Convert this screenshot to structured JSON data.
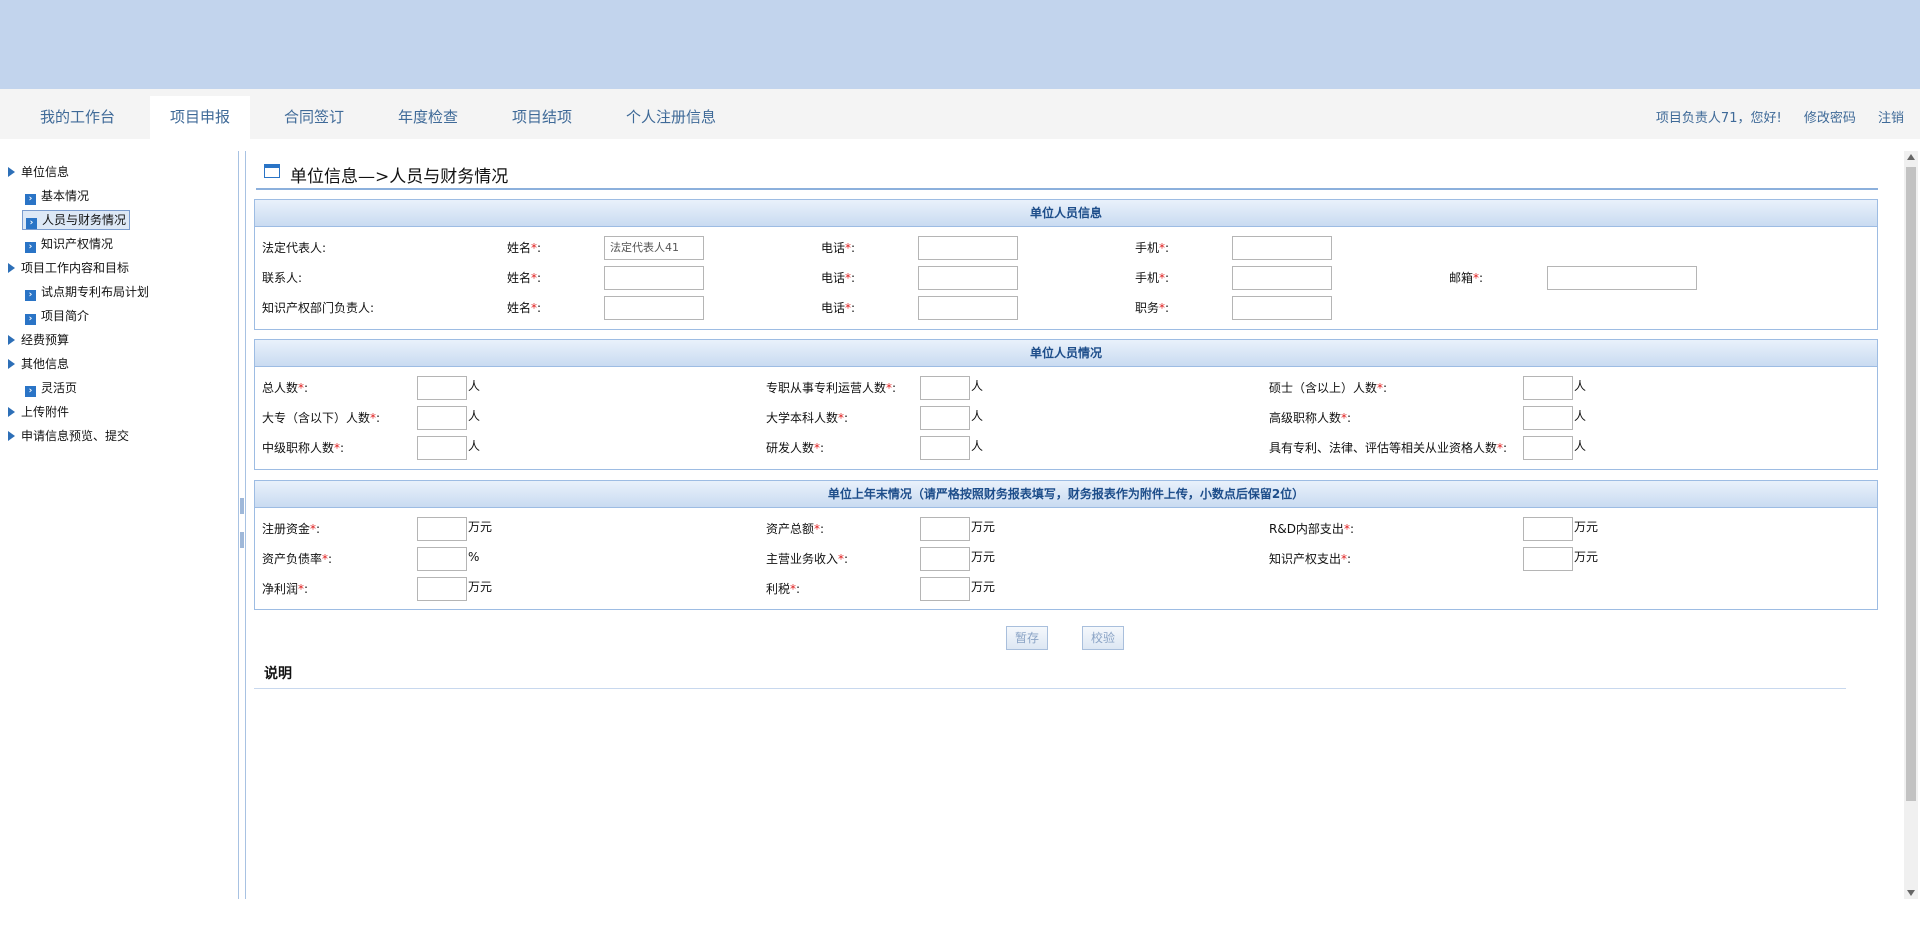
{
  "nav": {
    "tabs": [
      "我的工作台",
      "项目申报",
      "合同签订",
      "年度检查",
      "项目结项",
      "个人注册信息"
    ],
    "active_tab": "项目申报",
    "greeting": "项目负责人71，您好!",
    "change_password": "修改密码",
    "logout": "注销"
  },
  "sidebar": {
    "unit_info": "单位信息",
    "basic": "基本情况",
    "staff_finance": "人员与财务情况",
    "ip": "知识产权情况",
    "project_goals": "项目工作内容和目标",
    "pilot_plan": "试点期专利布局计划",
    "project_intro": "项目简介",
    "budget": "经费预算",
    "other": "其他信息",
    "flexible_page": "灵活页",
    "upload": "上传附件",
    "preview_submit": "申请信息预览、提交"
  },
  "page": {
    "title": "单位信息—>人员与财务情况"
  },
  "personnel_info": {
    "header": "单位人员信息",
    "legal_rep": "法定代表人:",
    "contact": "联系人:",
    "ip_head": "知识产权部门负责人:",
    "name": "姓名",
    "phone": "电话",
    "mobile": "手机",
    "email": "邮箱",
    "position": "职务",
    "req_mark": "*",
    "colon": ":",
    "legal_rep_name_value": "法定代表人41"
  },
  "personnel_stats": {
    "header": "单位人员情况",
    "total": "总人数",
    "patent_ops": "专职从事专利运营人数",
    "masters": "硕士（含以上）人数",
    "college": "大专（含以下）人数",
    "bachelor": "大学本科人数",
    "senior_title": "高级职称人数",
    "mid_title": "中级职称人数",
    "rnd": "研发人数",
    "qualified": "具有专利、法律、评估等相关从业资格人数",
    "unit": "人"
  },
  "finance": {
    "header": "单位上年末情况（请严格按照财务报表填写，财务报表作为附件上传，小数点后保留2位）",
    "registered_capital": "注册资金",
    "total_assets": "资产总额",
    "rnd_spend": "R&D内部支出",
    "debt_ratio": "资产负债率",
    "main_revenue": "主营业务收入",
    "ip_spend": "知识产权支出",
    "net_profit": "净利润",
    "tax": "利税",
    "unit_wan": "万元",
    "unit_pct": "%"
  },
  "actions": {
    "save_draft": "暂存",
    "validate": "校验"
  },
  "notes": {
    "title": "说明"
  }
}
